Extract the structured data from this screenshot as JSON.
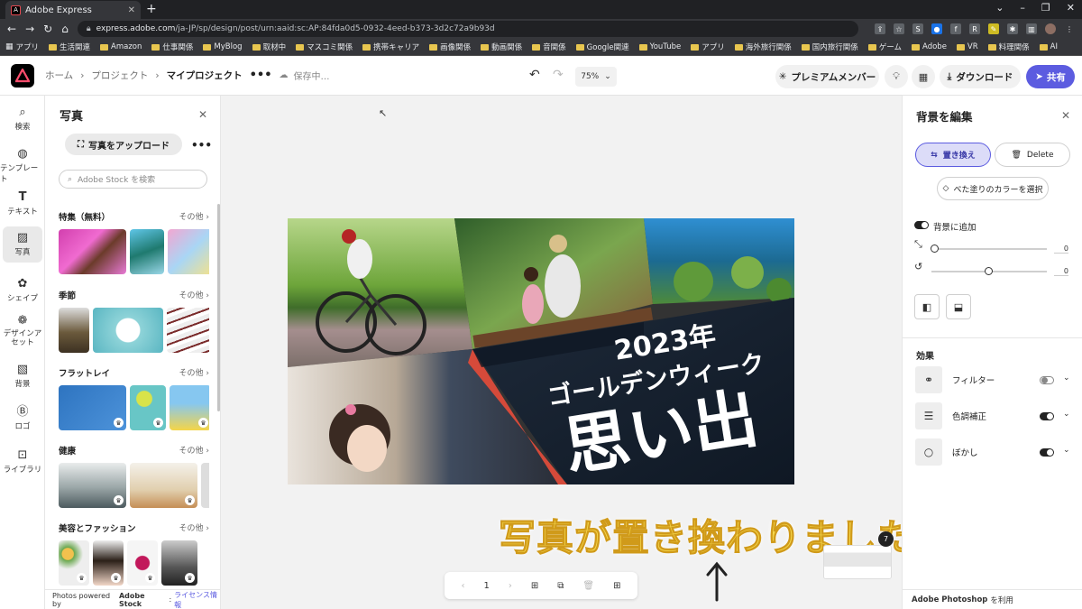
{
  "browser": {
    "tab_title": "Adobe Express",
    "url_host": "express.adobe.com",
    "url_path": "/ja-JP/sp/design/post/urn:aaid:sc:AP:84fda0d5-0932-4eed-b373-3d2c72a9b93d",
    "bookmarks": [
      "アプリ",
      "生活関連",
      "Amazon",
      "仕事関係",
      "MyBlog",
      "取材中",
      "マスコミ関係",
      "携帯キャリア",
      "画像関係",
      "動画関係",
      "音関係",
      "Google関連",
      "YouTube",
      "アプリ",
      "海外旅行関係",
      "国内旅行関係",
      "ゲーム",
      "Adobe",
      "VR",
      "料理関係",
      "AI"
    ]
  },
  "header": {
    "breadcrumb_home": "ホーム",
    "breadcrumb_projects": "プロジェクト",
    "breadcrumb_current": "マイプロジェクト",
    "more": "•••",
    "save_status": "保存中…",
    "zoom": "75%",
    "premium": "プレミアムメンバー",
    "download": "ダウンロード",
    "share": "共有"
  },
  "rail": [
    {
      "label": "検索",
      "icon": "search-icon"
    },
    {
      "label": "テンプレート",
      "icon": "template-icon"
    },
    {
      "label": "テキスト",
      "icon": "text-icon"
    },
    {
      "label": "写真",
      "icon": "photo-icon"
    },
    {
      "label": "シェイプ",
      "icon": "shape-icon"
    },
    {
      "label": "デザインアセット",
      "icon": "design-asset-icon"
    },
    {
      "label": "背景",
      "icon": "background-icon"
    },
    {
      "label": "ロゴ",
      "icon": "logo-icon"
    },
    {
      "label": "ライブラリ",
      "icon": "library-icon"
    }
  ],
  "photo_panel": {
    "title": "写真",
    "upload": "写真をアップロード",
    "search_placeholder": "Adobe Stock を検索",
    "more_label": "その他",
    "sections": [
      "特集（無料）",
      "季節",
      "フラットレイ",
      "健康",
      "美容とファッション"
    ],
    "footer_prefix": "Photos powered by",
    "footer_brand": "Adobe Stock",
    "footer_link": "ライセンス情報"
  },
  "design": {
    "year_line": "2023年",
    "subtitle": "ゴールデンウィーク",
    "main_text": "思い出"
  },
  "canvas": {
    "caption": "写真が置き換わりました",
    "page_number": "1",
    "page_count_badge": "7"
  },
  "right_panel": {
    "title": "背景を編集",
    "replace": "置き換え",
    "delete": "Delete",
    "fill_color": "べた塗りのカラーを選択",
    "add_to_background": "背景に追加",
    "slider1_value": "0",
    "slider2_value": "0",
    "effects_title": "効果",
    "effects": [
      {
        "label": "フィルター",
        "on": false
      },
      {
        "label": "色調補正",
        "on": true
      },
      {
        "label": "ぼかし",
        "on": true
      }
    ],
    "footer_brand": "Adobe Photoshop",
    "footer_suffix": "を利用"
  },
  "colors": {
    "accent": "#5c5ce0",
    "caption_yellow": "#f5d84b"
  }
}
